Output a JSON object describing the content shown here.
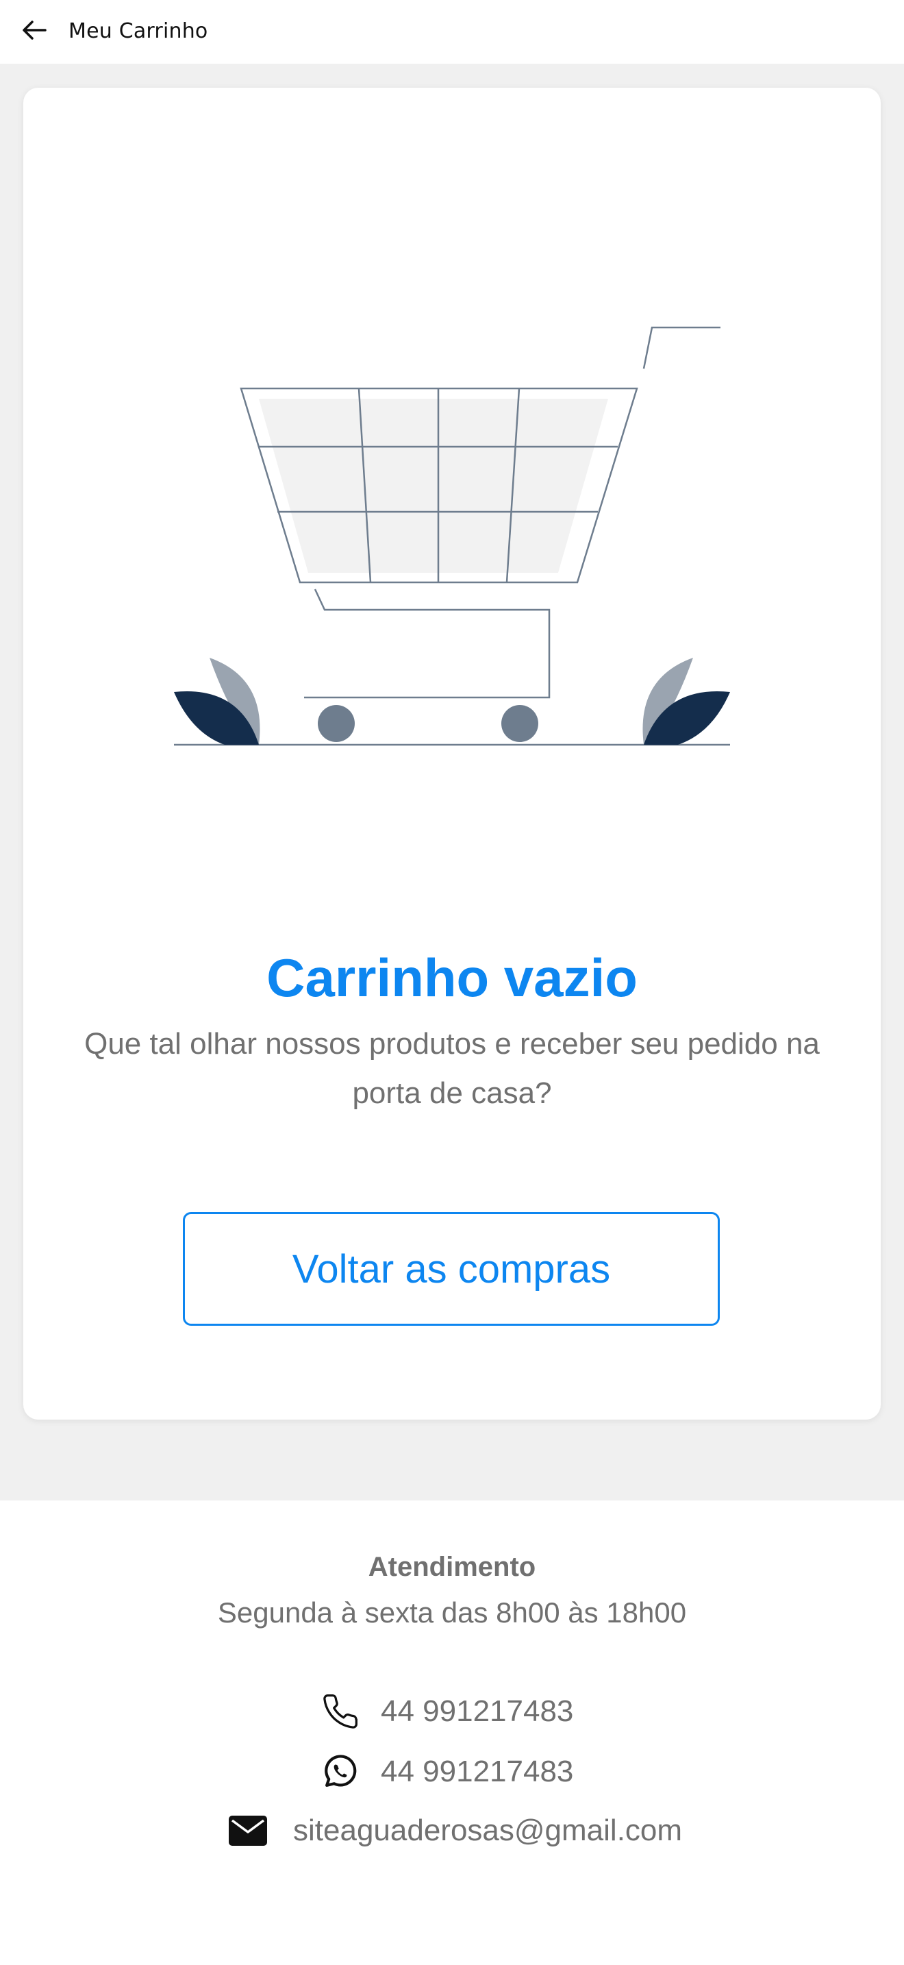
{
  "header": {
    "title": "Meu Carrinho",
    "back_icon": "arrow-left-icon"
  },
  "empty_state": {
    "illustration": "empty-shopping-cart-illustration",
    "title": "Carrinho vazio",
    "subtitle": "Que tal olhar nossos produtos e receber seu pedido na porta de casa?",
    "button_label": "Voltar as compras"
  },
  "footer": {
    "title": "Atendimento",
    "hours": "Segunda à sexta das 8h00 às 18h00",
    "contacts": [
      {
        "icon": "phone-icon",
        "text": "44 991217483"
      },
      {
        "icon": "whatsapp-icon",
        "text": "44 991217483"
      },
      {
        "icon": "mail-icon",
        "text": "siteaguaderosas@gmail.com"
      }
    ]
  },
  "colors": {
    "accent": "#0d86f0",
    "text_gray": "#707070",
    "background": "#f0f0f0",
    "leaf_dark": "#142d4c",
    "leaf_light": "#9aa4b0",
    "wheel": "#6e7d8e"
  }
}
